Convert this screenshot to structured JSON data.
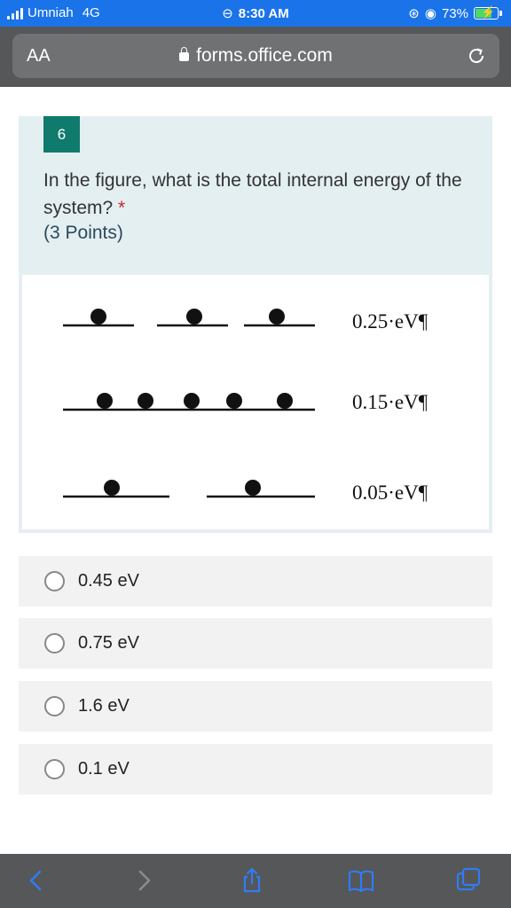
{
  "status": {
    "carrier": "Umniah",
    "network": "4G",
    "time": "8:30 AM",
    "battery": "73%",
    "battery_level": 0.73
  },
  "browser": {
    "text_size_label": "AA",
    "url": "forms.office.com"
  },
  "question": {
    "number": "6",
    "text": "In the figure, what is the total internal energy of the system?",
    "required_mark": "*",
    "points": "(3 Points)"
  },
  "figure": {
    "levels": [
      {
        "label": "0.25·eV¶",
        "energy_ev": 0.25,
        "particles": 3
      },
      {
        "label": "0.15·eV¶",
        "energy_ev": 0.15,
        "particles": 5
      },
      {
        "label": "0.05·eV¶",
        "energy_ev": 0.05,
        "particles": 2
      }
    ]
  },
  "options": [
    {
      "label": "0.45 eV",
      "selected": false
    },
    {
      "label": "0.75 eV",
      "selected": false
    },
    {
      "label": "1.6 eV",
      "selected": false
    },
    {
      "label": "0.1 eV",
      "selected": false
    }
  ],
  "toolbar": {
    "icons": [
      "back-icon",
      "forward-icon",
      "share-icon",
      "bookmarks-icon",
      "tabs-icon"
    ]
  },
  "colors": {
    "status_bar": "#1a73e8",
    "browser_chrome": "#555759",
    "accent": "#0f7b6c",
    "required": "#c4262e",
    "ios_blue": "#2f7cf6"
  }
}
